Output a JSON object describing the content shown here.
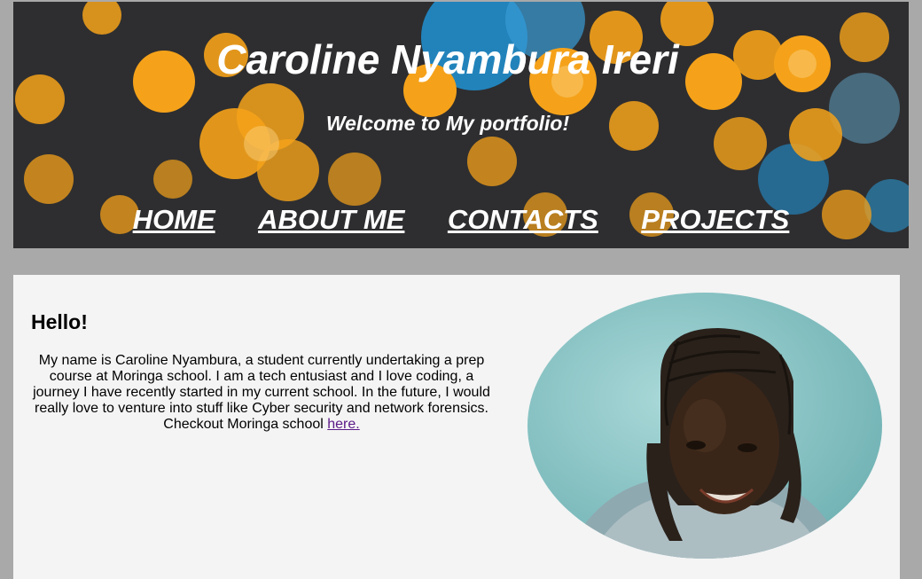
{
  "header": {
    "title": "Caroline Nyambura Ireri",
    "subtitle": "Welcome to My portfolio!",
    "nav": [
      {
        "label": "HOME"
      },
      {
        "label": "ABOUT ME"
      },
      {
        "label": "CONTACTS"
      },
      {
        "label": "PROJECTS"
      }
    ]
  },
  "about": {
    "heading": "Hello!",
    "bio": "My name is Caroline Nyambura, a student currently undertaking a prep course at Moringa school. I am a tech entusiast and I love coding, a journey I have recently started in my current school. In the future, I would really love to venture into stuff like Cyber security and network forensics. Checkout Moringa school ",
    "link_label": "here."
  },
  "colors": {
    "page_bg": "#a9a9a9",
    "panel_bg": "#f4f4f4",
    "link": "#5b1a87",
    "bokeh_orange": "#f5a21a",
    "bokeh_blue": "#1a9be0"
  },
  "icons": {
    "header_image": "bokeh-lights-banner",
    "profile_photo": "portrait-photo"
  }
}
